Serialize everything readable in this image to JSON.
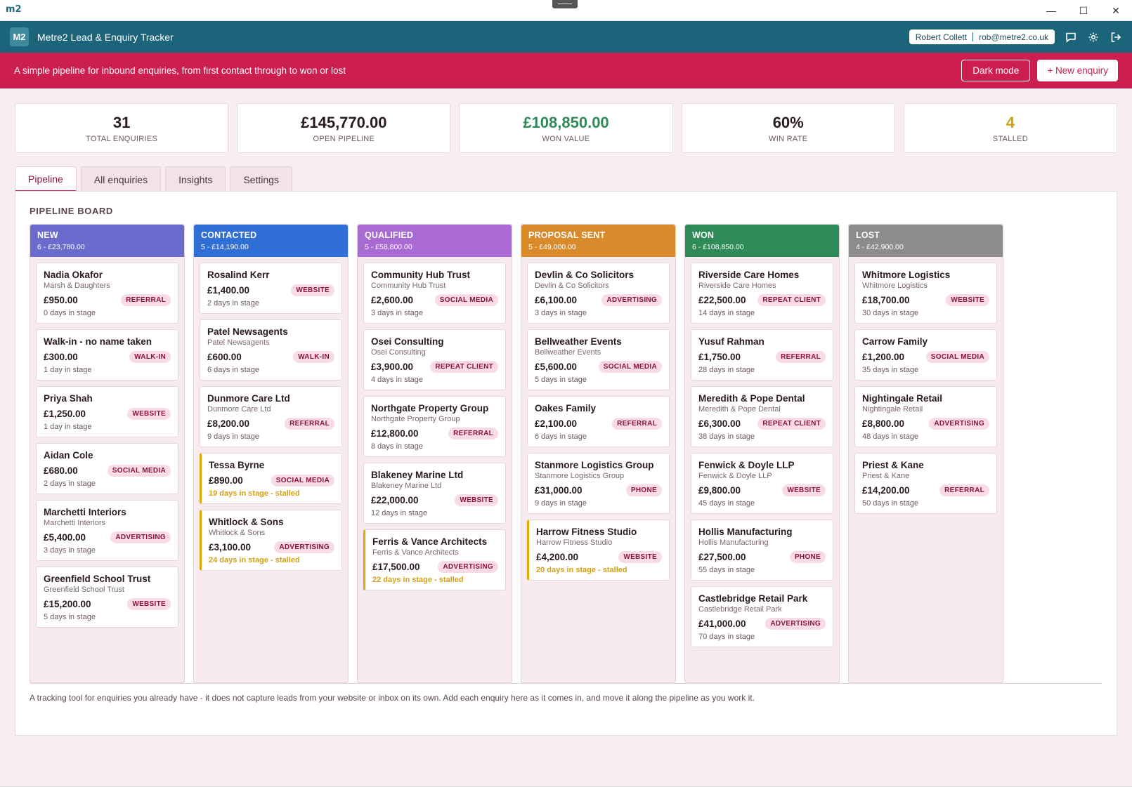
{
  "window": {
    "app_icon": "m2",
    "minimize": "—",
    "maximize": "☐",
    "close": "✕"
  },
  "header": {
    "logo": "M2",
    "title": "Metre2 Lead & Enquiry Tracker",
    "user_name": "Robert Collett",
    "user_email": "rob@metre2.co.uk",
    "icons": [
      "chat-icon",
      "gear-icon",
      "logout-icon"
    ]
  },
  "banner": {
    "tagline": "A simple pipeline for inbound enquiries, from first contact through to won or lost",
    "dark_mode": "Dark mode",
    "new_enquiry": "+ New enquiry"
  },
  "stats": [
    {
      "value": "31",
      "label": "TOTAL ENQUIRIES",
      "tone": ""
    },
    {
      "value": "£145,770.00",
      "label": "OPEN PIPELINE",
      "tone": ""
    },
    {
      "value": "£108,850.00",
      "label": "WON VALUE",
      "tone": "green"
    },
    {
      "value": "60%",
      "label": "WIN RATE",
      "tone": ""
    },
    {
      "value": "4",
      "label": "STALLED",
      "tone": "amber"
    }
  ],
  "tabs": [
    {
      "label": "Pipeline",
      "active": true
    },
    {
      "label": "All enquiries",
      "active": false
    },
    {
      "label": "Insights",
      "active": false
    },
    {
      "label": "Settings",
      "active": false
    }
  ],
  "board_title": "PIPELINE BOARD",
  "colors": {
    "new": "#6b6bce",
    "contacted": "#2f6fd6",
    "qualified": "#a96ad4",
    "proposal": "#d98b2b",
    "won": "#2e8b57",
    "lost": "#8c8c8c",
    "brand": "#cc1f50",
    "header": "#1b6479",
    "stalled": "#e0a800"
  },
  "columns": [
    {
      "key": "new",
      "name": "NEW",
      "meta": "6 - £23,780.00",
      "cards": [
        {
          "name": "Nadia Okafor",
          "org": "Marsh & Daughters",
          "value": "£950.00",
          "source": "REFERRAL",
          "days": "0 days in stage",
          "stalled": false
        },
        {
          "name": "Walk-in - no name taken",
          "org": "",
          "value": "£300.00",
          "source": "WALK-IN",
          "days": "1 day in stage",
          "stalled": false
        },
        {
          "name": "Priya Shah",
          "org": "",
          "value": "£1,250.00",
          "source": "WEBSITE",
          "days": "1 day in stage",
          "stalled": false
        },
        {
          "name": "Aidan Cole",
          "org": "",
          "value": "£680.00",
          "source": "SOCIAL MEDIA",
          "days": "2 days in stage",
          "stalled": false
        },
        {
          "name": "Marchetti Interiors",
          "org": "Marchetti Interiors",
          "value": "£5,400.00",
          "source": "ADVERTISING",
          "days": "3 days in stage",
          "stalled": false
        },
        {
          "name": "Greenfield School Trust",
          "org": "Greenfield School Trust",
          "value": "£15,200.00",
          "source": "WEBSITE",
          "days": "5 days in stage",
          "stalled": false
        }
      ]
    },
    {
      "key": "contacted",
      "name": "CONTACTED",
      "meta": "5 - £14,190.00",
      "cards": [
        {
          "name": "Rosalind Kerr",
          "org": "",
          "value": "£1,400.00",
          "source": "WEBSITE",
          "days": "2 days in stage",
          "stalled": false
        },
        {
          "name": "Patel Newsagents",
          "org": "Patel Newsagents",
          "value": "£600.00",
          "source": "WALK-IN",
          "days": "6 days in stage",
          "stalled": false
        },
        {
          "name": "Dunmore Care Ltd",
          "org": "Dunmore Care Ltd",
          "value": "£8,200.00",
          "source": "REFERRAL",
          "days": "9 days in stage",
          "stalled": false
        },
        {
          "name": "Tessa Byrne",
          "org": "",
          "value": "£890.00",
          "source": "SOCIAL MEDIA",
          "days": "19 days in stage - stalled",
          "stalled": true
        },
        {
          "name": "Whitlock & Sons",
          "org": "Whitlock & Sons",
          "value": "£3,100.00",
          "source": "ADVERTISING",
          "days": "24 days in stage - stalled",
          "stalled": true
        }
      ]
    },
    {
      "key": "qualified",
      "name": "QUALIFIED",
      "meta": "5 - £58,800.00",
      "cards": [
        {
          "name": "Community Hub Trust",
          "org": "Community Hub Trust",
          "value": "£2,600.00",
          "source": "SOCIAL MEDIA",
          "days": "3 days in stage",
          "stalled": false
        },
        {
          "name": "Osei Consulting",
          "org": "Osei Consulting",
          "value": "£3,900.00",
          "source": "REPEAT CLIENT",
          "days": "4 days in stage",
          "stalled": false
        },
        {
          "name": "Northgate Property Group",
          "org": "Northgate Property Group",
          "value": "£12,800.00",
          "source": "REFERRAL",
          "days": "8 days in stage",
          "stalled": false
        },
        {
          "name": "Blakeney Marine Ltd",
          "org": "Blakeney Marine Ltd",
          "value": "£22,000.00",
          "source": "WEBSITE",
          "days": "12 days in stage",
          "stalled": false
        },
        {
          "name": "Ferris & Vance Architects",
          "org": "Ferris & Vance Architects",
          "value": "£17,500.00",
          "source": "ADVERTISING",
          "days": "22 days in stage - stalled",
          "stalled": true
        }
      ]
    },
    {
      "key": "proposal",
      "name": "PROPOSAL SENT",
      "meta": "5 - £49,000.00",
      "cards": [
        {
          "name": "Devlin & Co Solicitors",
          "org": "Devlin & Co Solicitors",
          "value": "£6,100.00",
          "source": "ADVERTISING",
          "days": "3 days in stage",
          "stalled": false
        },
        {
          "name": "Bellweather Events",
          "org": "Bellweather Events",
          "value": "£5,600.00",
          "source": "SOCIAL MEDIA",
          "days": "5 days in stage",
          "stalled": false
        },
        {
          "name": "Oakes Family",
          "org": "",
          "value": "£2,100.00",
          "source": "REFERRAL",
          "days": "6 days in stage",
          "stalled": false
        },
        {
          "name": "Stanmore Logistics Group",
          "org": "Stanmore Logistics Group",
          "value": "£31,000.00",
          "source": "PHONE",
          "days": "9 days in stage",
          "stalled": false
        },
        {
          "name": "Harrow Fitness Studio",
          "org": "Harrow Fitness Studio",
          "value": "£4,200.00",
          "source": "WEBSITE",
          "days": "20 days in stage - stalled",
          "stalled": true
        }
      ]
    },
    {
      "key": "won",
      "name": "WON",
      "meta": "6 - £108,850.00",
      "cards": [
        {
          "name": "Riverside Care Homes",
          "org": "Riverside Care Homes",
          "value": "£22,500.00",
          "source": "REPEAT CLIENT",
          "days": "14 days in stage",
          "stalled": false
        },
        {
          "name": "Yusuf Rahman",
          "org": "",
          "value": "£1,750.00",
          "source": "REFERRAL",
          "days": "28 days in stage",
          "stalled": false
        },
        {
          "name": "Meredith & Pope Dental",
          "org": "Meredith & Pope Dental",
          "value": "£6,300.00",
          "source": "REPEAT CLIENT",
          "days": "38 days in stage",
          "stalled": false
        },
        {
          "name": "Fenwick & Doyle LLP",
          "org": "Fenwick & Doyle LLP",
          "value": "£9,800.00",
          "source": "WEBSITE",
          "days": "45 days in stage",
          "stalled": false
        },
        {
          "name": "Hollis Manufacturing",
          "org": "Hollis Manufacturing",
          "value": "£27,500.00",
          "source": "PHONE",
          "days": "55 days in stage",
          "stalled": false
        },
        {
          "name": "Castlebridge Retail Park",
          "org": "Castlebridge Retail Park",
          "value": "£41,000.00",
          "source": "ADVERTISING",
          "days": "70 days in stage",
          "stalled": false
        }
      ]
    },
    {
      "key": "lost",
      "name": "LOST",
      "meta": "4 - £42,900.00",
      "cards": [
        {
          "name": "Whitmore Logistics",
          "org": "Whitmore Logistics",
          "value": "£18,700.00",
          "source": "WEBSITE",
          "days": "30 days in stage",
          "stalled": false
        },
        {
          "name": "Carrow Family",
          "org": "",
          "value": "£1,200.00",
          "source": "SOCIAL MEDIA",
          "days": "35 days in stage",
          "stalled": false
        },
        {
          "name": "Nightingale Retail",
          "org": "Nightingale Retail",
          "value": "£8,800.00",
          "source": "ADVERTISING",
          "days": "48 days in stage",
          "stalled": false
        },
        {
          "name": "Priest & Kane",
          "org": "Priest & Kane",
          "value": "£14,200.00",
          "source": "REFERRAL",
          "days": "50 days in stage",
          "stalled": false
        }
      ]
    }
  ],
  "footnote": "A tracking tool for enquiries you already have - it does not capture leads from your website or inbox on its own. Add each enquiry here as it comes in, and move it along the pipeline as you work it."
}
